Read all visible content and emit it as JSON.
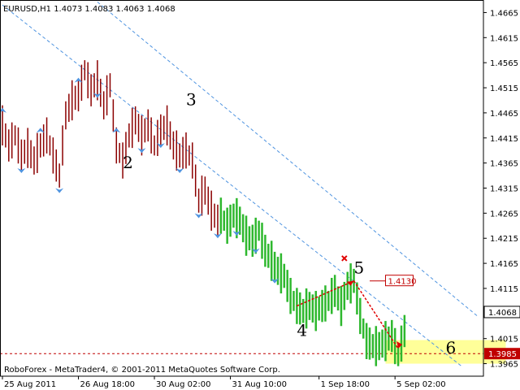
{
  "chart_data": {
    "type": "candlestick",
    "symbol_header": "EURUSD,H1  1.4073 1.4083 1.4063 1.4068",
    "copyright": "RoboForex - MetaTrader4, © 2001-2011 MetaQuotes Software Corp.",
    "ylim": [
      1.394,
      1.469
    ],
    "y_ticks": [
      "1.4665",
      "1.4615",
      "1.4565",
      "1.4515",
      "1.4465",
      "1.4415",
      "1.4365",
      "1.4315",
      "1.4265",
      "1.4215",
      "1.4165",
      "1.4115",
      "1.4015",
      "1.3965"
    ],
    "current_price": "1.4068",
    "target_price": "1.3985",
    "marked_level": "1.4130",
    "x_ticks": [
      "25 Aug 2011",
      "26 Aug 18:00",
      "30 Aug 02:00",
      "31 Aug 10:00",
      "1 Sep 18:00",
      "5 Sep 02:00"
    ],
    "wave_labels": [
      {
        "label": "2",
        "price": 1.4355,
        "index": 38
      },
      {
        "label": "3",
        "price": 1.448,
        "index": 58
      },
      {
        "label": "4",
        "price": 1.402,
        "index": 93
      },
      {
        "label": "5",
        "price": 1.4145,
        "index": 111
      },
      {
        "label": "6",
        "price": 1.3985,
        "index": 140
      }
    ],
    "colors": {
      "bear_bars": "#8b0000",
      "bull_bars": "#2eb82e",
      "fractals": "#4f94e0",
      "channel": "#4f94e0",
      "forecast_arrow": "#e00000",
      "target_zone": "#ffff99",
      "target_line": "#c00000",
      "price_tag_bg": "#c00000"
    },
    "segments": [
      {
        "color": "bear",
        "from": 0,
        "to": 69,
        "points": [
          [
            0,
            1.444
          ],
          [
            2,
            1.44
          ],
          [
            4,
            1.442
          ],
          [
            6,
            1.438
          ],
          [
            8,
            1.4395
          ],
          [
            10,
            1.437
          ],
          [
            12,
            1.44
          ],
          [
            14,
            1.442
          ],
          [
            16,
            1.438
          ],
          [
            18,
            1.434
          ],
          [
            20,
            1.446
          ],
          [
            22,
            1.449
          ],
          [
            24,
            1.45
          ],
          [
            26,
            1.455
          ],
          [
            28,
            1.451
          ],
          [
            30,
            1.453
          ],
          [
            32,
            1.448
          ],
          [
            34,
            1.452
          ],
          [
            36,
            1.44
          ],
          [
            38,
            1.437
          ],
          [
            40,
            1.442
          ],
          [
            42,
            1.445
          ],
          [
            44,
            1.442
          ],
          [
            46,
            1.444
          ],
          [
            48,
            1.44
          ],
          [
            50,
            1.443
          ],
          [
            52,
            1.444
          ],
          [
            54,
            1.44
          ],
          [
            56,
            1.438
          ],
          [
            58,
            1.439
          ],
          [
            60,
            1.437
          ],
          [
            62,
            1.429
          ],
          [
            64,
            1.431
          ],
          [
            66,
            1.427
          ],
          [
            68,
            1.425
          ]
        ]
      },
      {
        "color": "bull",
        "from": 69,
        "to": 128,
        "points": [
          [
            69,
            1.426
          ],
          [
            71,
            1.424
          ],
          [
            73,
            1.426
          ],
          [
            75,
            1.425
          ],
          [
            77,
            1.422
          ],
          [
            79,
            1.421
          ],
          [
            81,
            1.423
          ],
          [
            83,
            1.419
          ],
          [
            85,
            1.417
          ],
          [
            87,
            1.415
          ],
          [
            89,
            1.414
          ],
          [
            91,
            1.41
          ],
          [
            93,
            1.408
          ],
          [
            95,
            1.407
          ],
          [
            97,
            1.408
          ],
          [
            99,
            1.407
          ],
          [
            101,
            1.408
          ],
          [
            103,
            1.409
          ],
          [
            105,
            1.411
          ],
          [
            107,
            1.408
          ],
          [
            109,
            1.412
          ],
          [
            111,
            1.413
          ],
          [
            113,
            1.406
          ],
          [
            115,
            1.401
          ],
          [
            117,
            1.4
          ],
          [
            119,
            1.4
          ],
          [
            121,
            1.401
          ],
          [
            123,
            1.402
          ],
          [
            125,
            1.398
          ],
          [
            127,
            1.403
          ]
        ]
      }
    ]
  }
}
